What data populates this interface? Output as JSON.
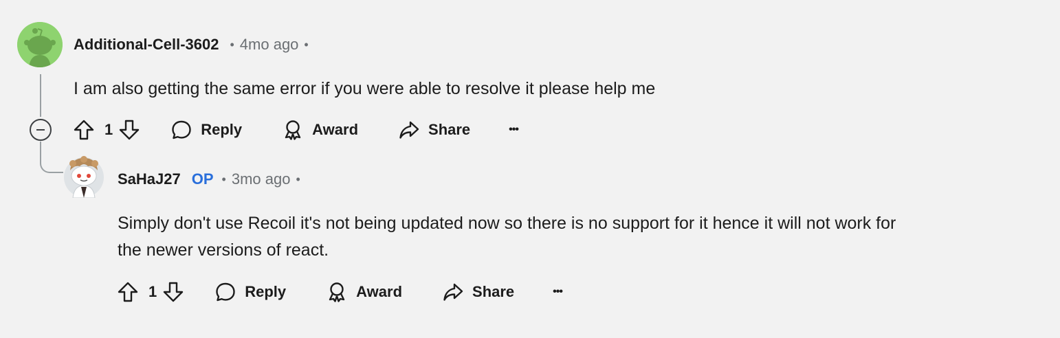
{
  "comments": [
    {
      "username": "Additional-Cell-3602",
      "timestamp": "4mo ago",
      "body": "I am also getting the same error if you were able to resolve it please help me",
      "votes": "1",
      "actions": {
        "reply": "Reply",
        "award": "Award",
        "share": "Share",
        "more": "•••"
      }
    },
    {
      "username": "SaHaJ27",
      "badge": "OP",
      "timestamp": "3mo ago",
      "body_line1": "Simply don't use Recoil it's not being updated now so there is no support for it hence it will not work for",
      "body_line2": "the newer versions of react.",
      "votes": "1",
      "actions": {
        "reply": "Reply",
        "award": "Award",
        "share": "Share",
        "more": "•••"
      }
    }
  ],
  "colors": {
    "background": "#f2f2f2",
    "text": "#1c1c1c",
    "muted": "#6b6f73",
    "op_badge": "#2a6fdb",
    "avatar1_bg": "#8ed36f"
  },
  "icons": {
    "upvote": "arrow-up-outline",
    "downvote": "arrow-down-outline",
    "reply": "speech-bubble-outline",
    "award": "award-ribbon-outline",
    "share": "share-arrow-outline",
    "more": "ellipsis",
    "collapse": "minus-circle"
  }
}
